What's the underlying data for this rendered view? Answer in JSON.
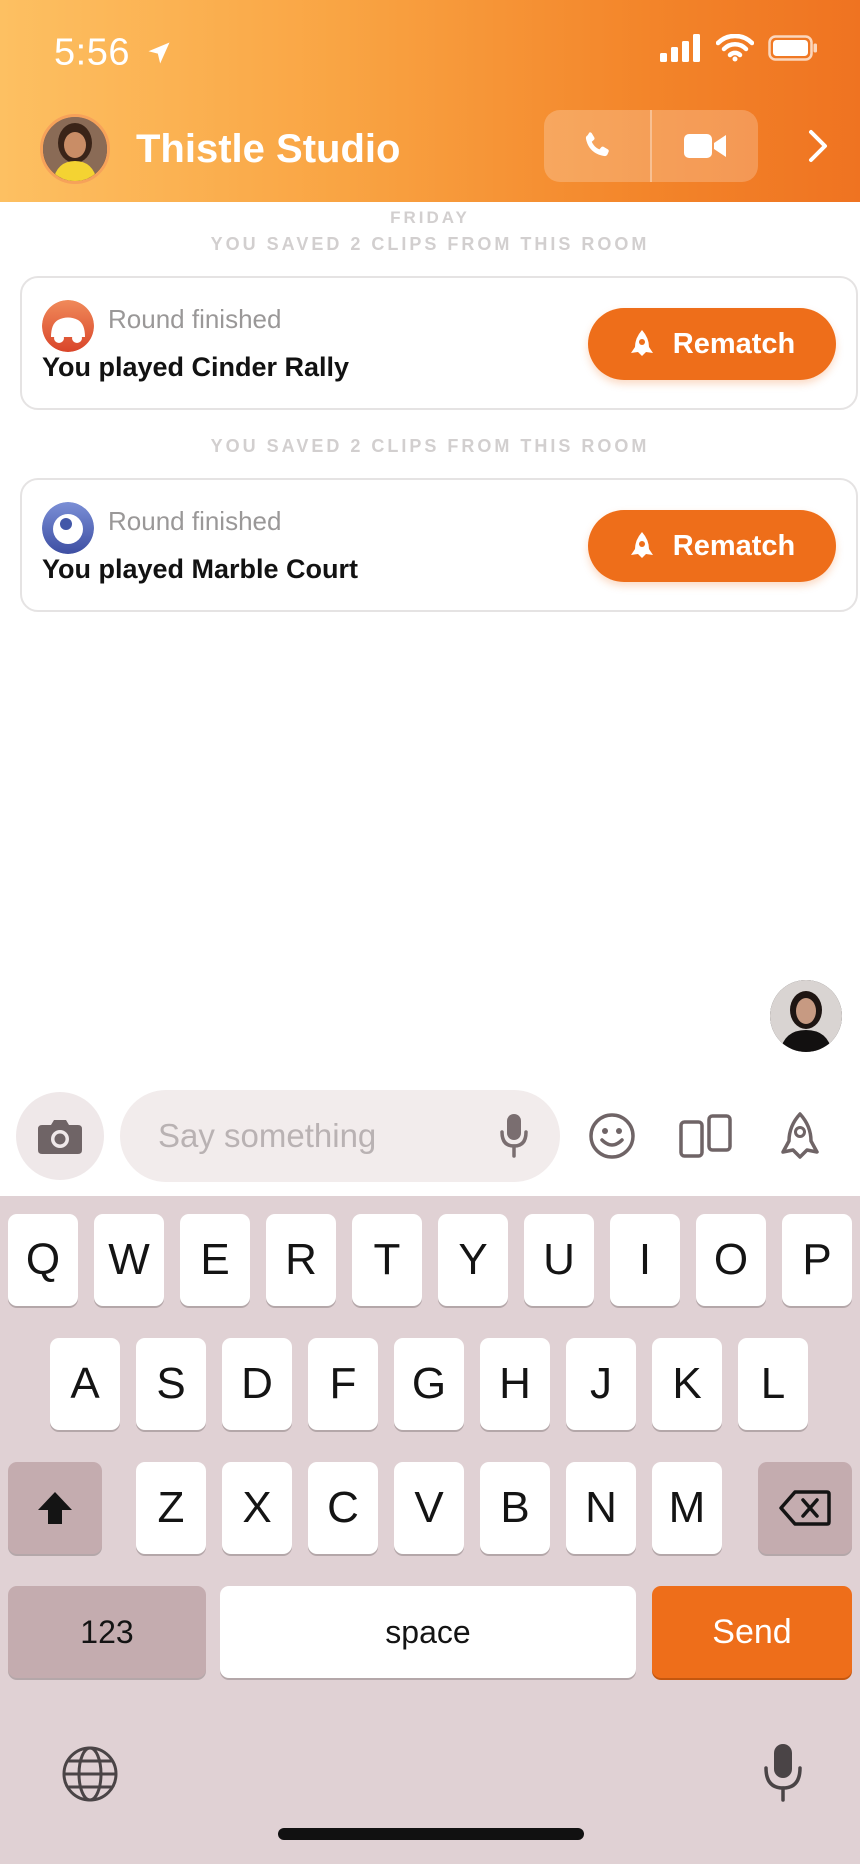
{
  "status_bar": {
    "time": "5:56"
  },
  "header": {
    "title": "Thistle Studio"
  },
  "messages": {
    "day_label": "FRIDAY",
    "items": [
      {
        "saved_note": "YOU SAVED 2 CLIPS FROM THIS ROOM",
        "status": "Round finished",
        "text": "You played Cinder Rally",
        "button": "Rematch"
      },
      {
        "saved_note": "YOU SAVED 2 CLIPS FROM THIS ROOM",
        "status": "Round finished",
        "text": "You played Marble Court",
        "button": "Rematch"
      }
    ]
  },
  "composer": {
    "placeholder": "Say something"
  },
  "keyboard": {
    "row1": [
      "Q",
      "W",
      "E",
      "R",
      "T",
      "Y",
      "U",
      "I",
      "O",
      "P"
    ],
    "row2": [
      "A",
      "S",
      "D",
      "F",
      "G",
      "H",
      "J",
      "K",
      "L"
    ],
    "row3": [
      "Z",
      "X",
      "C",
      "V",
      "B",
      "N",
      "M"
    ],
    "numbers_label": "123",
    "space_label": "space",
    "send_label": "Send"
  },
  "colors": {
    "accent": "#ee6e1a",
    "header_start": "#fdc062",
    "header_end": "#ef7321",
    "keyboard_bg": "#e0d1d4"
  }
}
